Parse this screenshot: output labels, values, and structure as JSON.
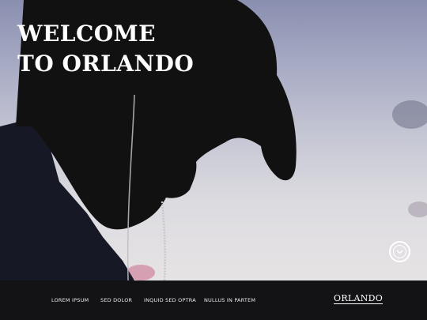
{
  "hero": {
    "title_line1": "WELCOME",
    "title_line2": "TO ORLANDO",
    "image": "silhouette-of-man-in-cowboy-hat"
  },
  "scroll_button": {
    "icon": "chevron-down-circle-icon"
  },
  "nav": {
    "items": [
      {
        "label": "LOREM IPSUM"
      },
      {
        "label": "SED DOLOR"
      },
      {
        "label": "INQUID SED OPTRA"
      },
      {
        "label": "NULLUS IN PARTEM"
      }
    ],
    "brand": "ORLANDO"
  },
  "colors": {
    "nav_background": "#131316",
    "sky_top": "#8a8fb0",
    "sky_bottom": "#e6e3e4",
    "text": "#ffffff"
  }
}
